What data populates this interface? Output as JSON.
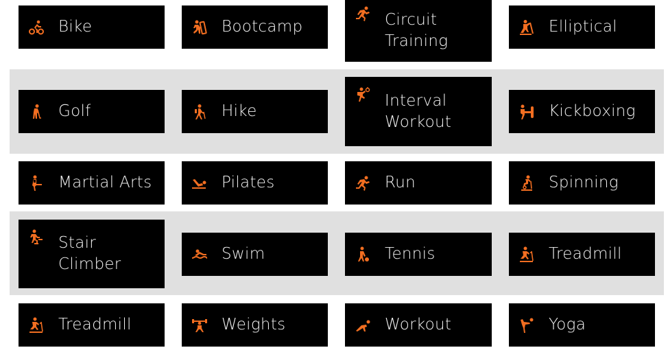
{
  "accent_color": "#f26e21",
  "tile_background": "#000000",
  "band_background": "#e0e0e0",
  "label_color": "#f2f2f2",
  "tiles": [
    {
      "label": "Bike",
      "icon": "bike-icon"
    },
    {
      "label": "Bootcamp",
      "icon": "bootcamp-icon"
    },
    {
      "label": "Circuit\nTraining",
      "icon": "circuit-training-icon"
    },
    {
      "label": "Elliptical",
      "icon": "elliptical-icon"
    },
    {
      "label": "Golf",
      "icon": "golf-icon"
    },
    {
      "label": "Hike",
      "icon": "hike-icon"
    },
    {
      "label": "Interval\nWorkout",
      "icon": "interval-workout-icon"
    },
    {
      "label": "Kickboxing",
      "icon": "kickboxing-icon"
    },
    {
      "label": "Martial Arts",
      "icon": "martial-arts-icon"
    },
    {
      "label": "Pilates",
      "icon": "pilates-icon"
    },
    {
      "label": "Run",
      "icon": "run-icon"
    },
    {
      "label": "Spinning",
      "icon": "spinning-icon"
    },
    {
      "label": "Stair\nClimber",
      "icon": "stair-climber-icon"
    },
    {
      "label": "Swim",
      "icon": "swim-icon"
    },
    {
      "label": "Tennis",
      "icon": "tennis-icon"
    },
    {
      "label": "Treadmill",
      "icon": "treadmill-icon"
    },
    {
      "label": "Treadmill",
      "icon": "treadmill-icon"
    },
    {
      "label": "Weights",
      "icon": "weights-icon"
    },
    {
      "label": "Workout",
      "icon": "workout-icon"
    },
    {
      "label": "Yoga",
      "icon": "yoga-icon"
    }
  ]
}
